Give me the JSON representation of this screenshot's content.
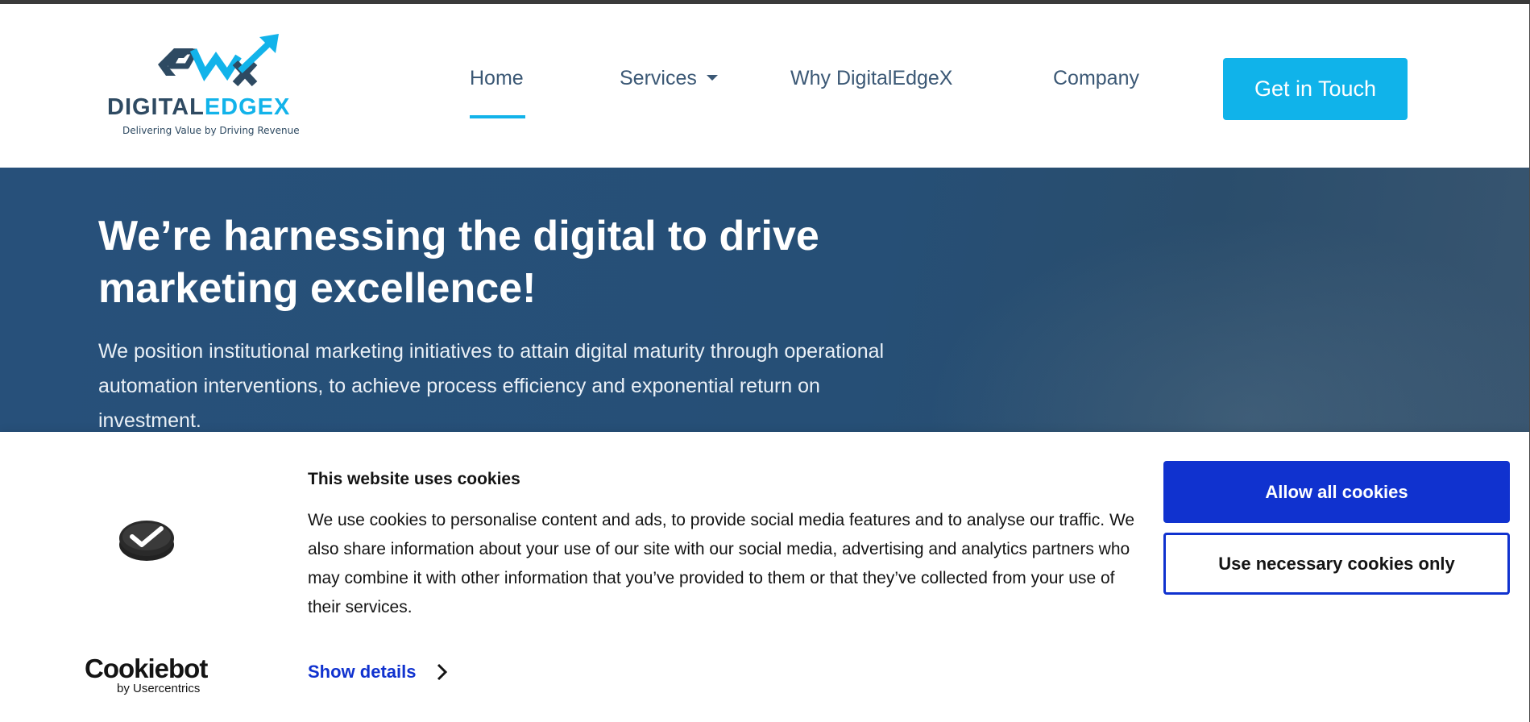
{
  "brand": {
    "name_dark": "DIGITAL",
    "name_accent": "EDGEX",
    "tagline": "Delivering Value by Driving Revenue",
    "colors": {
      "primary": "#2e4a62",
      "accent": "#12b3ea"
    }
  },
  "nav": {
    "items": [
      {
        "label": "Home",
        "active": true
      },
      {
        "label": "Services",
        "has_dropdown": true
      },
      {
        "label": "Why DigitalEdgeX"
      },
      {
        "label": "Company"
      }
    ],
    "cta_label": "Get in Touch"
  },
  "hero": {
    "title": "We’re harnessing the digital to drive marketing excellence!",
    "subtitle": "We position institutional marketing initiatives to attain digital maturity through operational automation interventions, to achieve process efficiency and exponential return on investment."
  },
  "cookie_banner": {
    "title": "This website uses cookies",
    "body": "We use cookies to personalise content and ads, to provide social media features and to analyse our traffic. We also share information about your use of our site with our social media, advertising and analytics partners who may combine it with other information that you’ve provided to them or that they’ve collected from your use of their services.",
    "show_details_label": "Show details",
    "allow_all_label": "Allow all cookies",
    "necessary_only_label": "Use necessary cookies only",
    "provider_name": "Cookiebot",
    "provider_by": "by Usercentrics",
    "colors": {
      "button_primary": "#1032cf"
    }
  }
}
